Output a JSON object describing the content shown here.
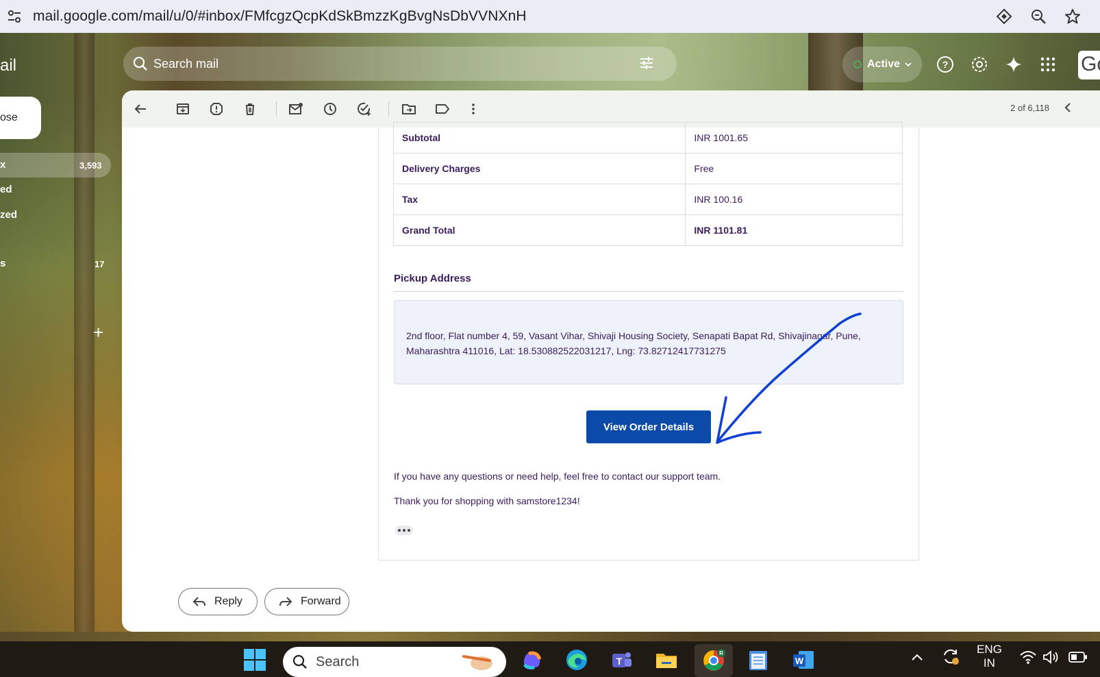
{
  "browser": {
    "url": "mail.google.com/mail/u/0/#inbox/FMfcgzQcpKdSkBmzzKgBvgNsDbVVNXnH"
  },
  "gmail": {
    "logo": "ail",
    "search_placeholder": "Search mail",
    "status": "Active",
    "account_initial": "Go"
  },
  "sidebar": {
    "compose": "ose",
    "items": [
      {
        "label": "x",
        "count": "3,593"
      },
      {
        "label": "ed"
      },
      {
        "label": "zed"
      },
      {
        "label": "s",
        "count": "17"
      }
    ]
  },
  "toolbar": {
    "pager": "2 of 6,118"
  },
  "email": {
    "summary": [
      {
        "label": "Subtotal",
        "value": "INR 1001.65"
      },
      {
        "label": "Delivery Charges",
        "value": "Free"
      },
      {
        "label": "Tax",
        "value": "INR 100.16"
      },
      {
        "label": "Grand Total",
        "value": "INR 1101.81"
      }
    ],
    "pickup_title": "Pickup Address",
    "pickup_address": "2nd floor, Flat number 4, 59, Vasant Vihar, Shivaji Housing Society, Senapati Bapat Rd, Shivajinagar, Pune, Maharashtra 411016, Lat: 18.530882522031217, Lng: 73.82712417731275",
    "view_button": "View Order Details",
    "help_text": "If you have any questions or need help, feel free to contact our support team.",
    "thanks_text": "Thank you for shopping with samstore1234!"
  },
  "actions": {
    "reply": "Reply",
    "forward": "Forward"
  },
  "taskbar": {
    "search_label": "Search",
    "lang_1": "ENG",
    "lang_2": "IN"
  },
  "colors": {
    "primary_button": "#0b4aa8",
    "text_purple": "#3a1c5c",
    "annotation_arrow": "#1040d0"
  }
}
